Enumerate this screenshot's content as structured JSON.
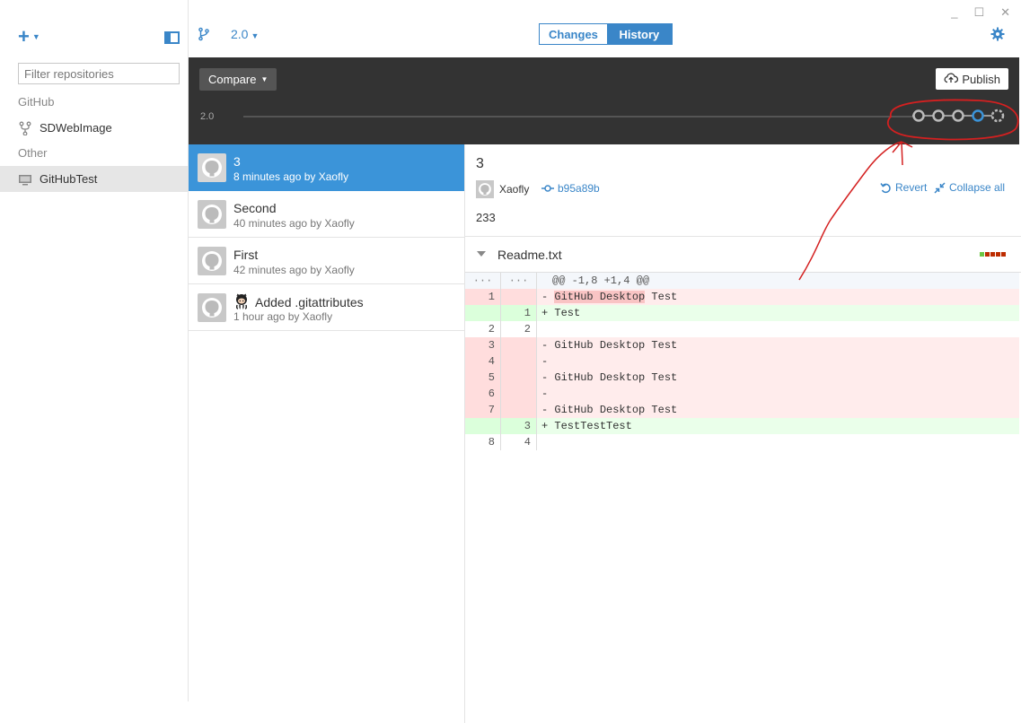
{
  "window": {
    "minimize": "_",
    "maximize": "☐",
    "close": "✕"
  },
  "sidebar": {
    "add_label": "+",
    "filter_placeholder": "Filter repositories",
    "groups": [
      {
        "label": "GitHub",
        "items": [
          {
            "label": "SDWebImage",
            "icon": "fork-icon"
          }
        ]
      },
      {
        "label": "Other",
        "items": [
          {
            "label": "GitHubTest",
            "icon": "monitor-icon",
            "selected": true
          }
        ]
      }
    ]
  },
  "toolbar": {
    "branch": "2.0",
    "tab_changes": "Changes",
    "tab_history": "History",
    "active_tab": "History"
  },
  "compare_bar": {
    "compare_label": "Compare",
    "publish_label": "Publish",
    "timeline_label": "2.0",
    "timeline_nodes": 5,
    "selected_node": 4
  },
  "commits": [
    {
      "title": "3",
      "meta": "8 minutes ago by Xaofly",
      "selected": true
    },
    {
      "title": "Second",
      "meta": "40 minutes ago by Xaofly",
      "selected": false
    },
    {
      "title": "First",
      "meta": "42 minutes ago by Xaofly",
      "selected": false
    },
    {
      "title": "Added .gitattributes",
      "meta": "1 hour ago by Xaofly",
      "selected": false,
      "emoji": "octocat"
    }
  ],
  "detail": {
    "title": "3",
    "author": "Xaofly",
    "sha": "b95a89b",
    "revert_label": "Revert",
    "collapse_label": "Collapse all",
    "description": "233",
    "file": {
      "name": "Readme.txt",
      "diffstat_colors": [
        "#6cc644",
        "#bd2c00",
        "#bd2c00",
        "#bd2c00",
        "#bd2c00"
      ],
      "lines": [
        {
          "type": "hunk",
          "old": "···",
          "new": "···",
          "text": "@@ -1,8 +1,4 @@"
        },
        {
          "type": "del",
          "old": "1",
          "new": "",
          "sign": "-",
          "text": "GitHub Desktop Test",
          "highlight": "GitHub Desktop"
        },
        {
          "type": "add",
          "old": "",
          "new": "1",
          "sign": "+",
          "text": "Test"
        },
        {
          "type": "ctx",
          "old": "2",
          "new": "2",
          "sign": " ",
          "text": ""
        },
        {
          "type": "del",
          "old": "3",
          "new": "",
          "sign": "-",
          "text": "GitHub Desktop Test"
        },
        {
          "type": "del",
          "old": "4",
          "new": "",
          "sign": "-",
          "text": ""
        },
        {
          "type": "del",
          "old": "5",
          "new": "",
          "sign": "-",
          "text": "GitHub Desktop Test"
        },
        {
          "type": "del",
          "old": "6",
          "new": "",
          "sign": "-",
          "text": ""
        },
        {
          "type": "del",
          "old": "7",
          "new": "",
          "sign": "-",
          "text": "GitHub Desktop Test"
        },
        {
          "type": "add",
          "old": "",
          "new": "3",
          "sign": "+",
          "text": "TestTestTest"
        },
        {
          "type": "ctx",
          "old": "8",
          "new": "4",
          "sign": " ",
          "text": ""
        }
      ]
    }
  },
  "colors": {
    "accent": "#3a86c8",
    "dark_bar": "#333333",
    "annotation": "#d42020"
  }
}
